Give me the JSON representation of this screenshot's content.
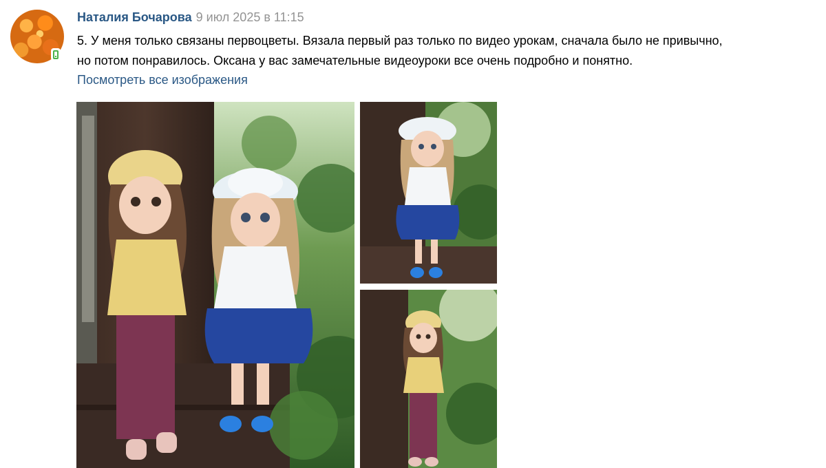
{
  "comment": {
    "author": "Наталия Бочарова",
    "date": "9 июл 2025 в 11:15",
    "text_line1": "5. У меня только связаны первоцветы. Вязала первый раз только по видео урокам, сначала было не привычно,",
    "text_line2": "но потом понравилось. Оксана у вас замечательные видеоуроки все очень подробно и понятно.",
    "view_all_label": "Посмотреть все изображения"
  },
  "icons": {
    "online": "mobile-online-icon"
  },
  "colors": {
    "link": "#2a5885",
    "date": "#939393",
    "online": "#4bb34b"
  }
}
